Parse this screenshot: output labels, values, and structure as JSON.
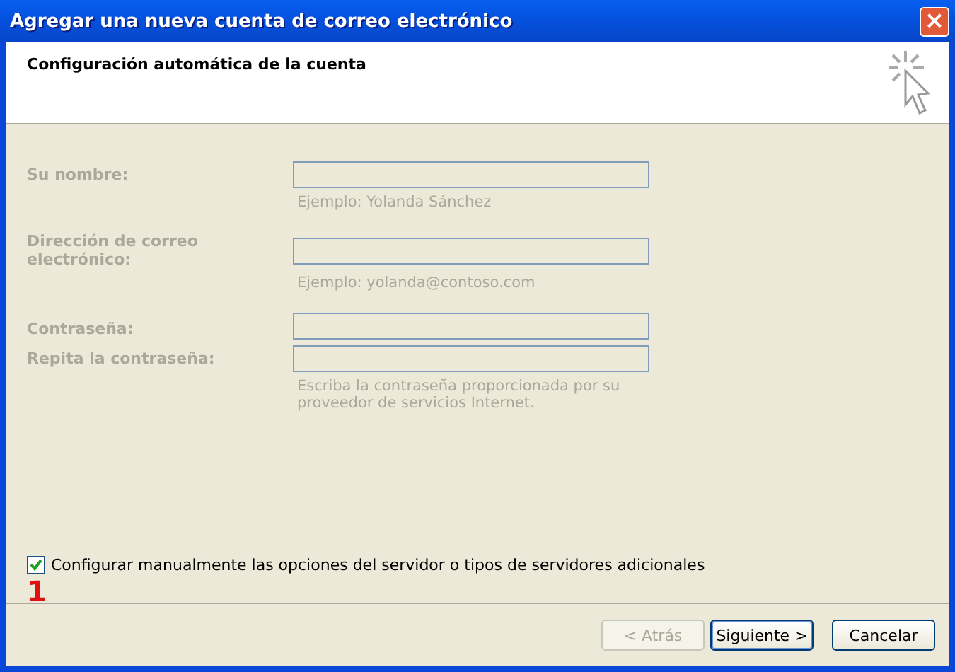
{
  "window": {
    "title": "Agregar una nueva cuenta de correo electrónico",
    "close": "×"
  },
  "header": {
    "title": "Configuración automática de la cuenta"
  },
  "fields": [
    {
      "label": "Su nombre:",
      "disabled": true,
      "hint": "Ejemplo: Yolanda Sánchez"
    },
    {
      "label": "Dirección de correo electrónico:",
      "disabled": true,
      "hint": "Ejemplo: yolanda@contoso.com"
    },
    {
      "label": "Contraseña:",
      "disabled": true
    },
    {
      "label": "Repita la contraseña:",
      "disabled": true,
      "hint": "Escriba la contraseña proporcionada por su proveedor de servicios Internet."
    }
  ],
  "manual_option": {
    "label": "Configurar manualmente las opciones del servidor o tipos de servidores adicionales",
    "checked": true
  },
  "annotation": "1",
  "buttons": [
    {
      "label": "< Atrás",
      "disabled": true,
      "default": false
    },
    {
      "label": "Siguiente >",
      "disabled": false,
      "default": true
    },
    {
      "label": "Cancelar",
      "disabled": false,
      "default": false
    }
  ]
}
